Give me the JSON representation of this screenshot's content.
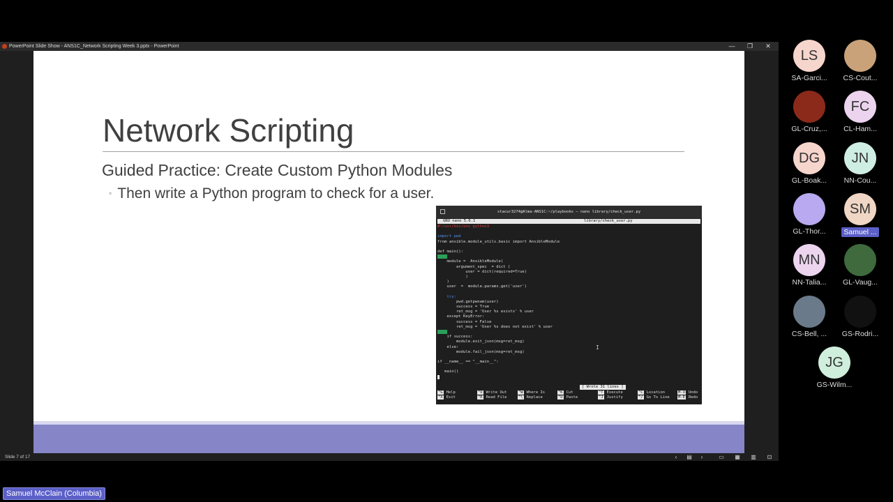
{
  "window": {
    "title": "PowerPoint Slide Show  -  ANS1C_Network Scripting Week 3.pptx - PowerPoint",
    "minimize_glyph": "—",
    "restore_glyph": "❐",
    "close_glyph": "✕"
  },
  "slide": {
    "title": "Network Scripting",
    "heading": "Guided Practice: Create Custom Python Modules",
    "bullet": "Then write a Python program to check for a user.",
    "bullet_marker": "◦"
  },
  "terminal": {
    "window_title": "stacur3274@Alma-ANS1C:~/playbooks — nano library/check_user.py",
    "nano_version": "GNU nano 5.6.1",
    "file_name": "library/check_user.py",
    "code": {
      "shebang": "#!/usr/bin/env python3",
      "l1": "import pwd",
      "l2": "from ansible.module_utils.basic import AnsibleModule",
      "l3": "def main():",
      "l4": "    module =  AnsibleModule(",
      "l5": "        argument_spec  = dict (",
      "l6": "            user = dict(required=True)",
      "l7": "            )",
      "l8": "    )",
      "l9": "    user  =  module.params.get('user')",
      "l10": "    try:",
      "l11": "        pwd.getpwnam(user)",
      "l12": "        success = True",
      "l13": "        ret_msg = 'User %s exists' % user",
      "l14": "    except KeyError:",
      "l15": "        success = False",
      "l16": "        ret_msg = 'User %s does not exist' % user",
      "l17": "    if success:",
      "l18": "        module.exit_json(msg=ret_msg)",
      "l19": "    else:",
      "l20": "        module.fail_json(msg=ret_msg)",
      "l21": "if __name__ == \"__main__\":",
      "l22": "   main()"
    },
    "status_message": "[ Wrote 31 lines ]",
    "shortcuts": [
      {
        "key": "^G",
        "label": "Help"
      },
      {
        "key": "^O",
        "label": "Write Out"
      },
      {
        "key": "^W",
        "label": "Where Is"
      },
      {
        "key": "^K",
        "label": "Cut"
      },
      {
        "key": "^T",
        "label": "Execute"
      },
      {
        "key": "^C",
        "label": "Location"
      },
      {
        "key": "M-U",
        "label": "Undo"
      },
      {
        "key": "^X",
        "label": "Exit"
      },
      {
        "key": "^R",
        "label": "Read File"
      },
      {
        "key": "^\\",
        "label": "Replace"
      },
      {
        "key": "^U",
        "label": "Paste"
      },
      {
        "key": "^J",
        "label": "Justify"
      },
      {
        "key": "^/",
        "label": "Go To Line"
      },
      {
        "key": "M-E",
        "label": "Redo"
      }
    ]
  },
  "statusbar": {
    "slide_count": "Slide 7 of 17"
  },
  "participants": [
    {
      "initials": "LS",
      "name": "SA-Garci...",
      "color": "#f6d5cc",
      "photo": false
    },
    {
      "initials": "",
      "name": "CS-Cout...",
      "color": "#c9a27a",
      "photo": true
    },
    {
      "initials": "",
      "name": "GL-Cruz,...",
      "color": "#8b2a1a",
      "photo": true
    },
    {
      "initials": "FC",
      "name": "CL-Ham...",
      "color": "#ecd4ef",
      "photo": false
    },
    {
      "initials": "DG",
      "name": "GL-Boak...",
      "color": "#f6d5cc",
      "photo": false
    },
    {
      "initials": "JN",
      "name": "NN-Cou...",
      "color": "#cfeee3",
      "photo": false
    },
    {
      "initials": "",
      "name": "GL-Thor...",
      "color": "#b8a9f0",
      "photo": true
    },
    {
      "initials": "SM",
      "name": "Samuel ...",
      "color": "#f0d6c4",
      "photo": false
    },
    {
      "initials": "MN",
      "name": "NN-Talia...",
      "color": "#ecd4ef",
      "photo": false
    },
    {
      "initials": "",
      "name": "GL-Vaug...",
      "color": "#3e6a3e",
      "photo": true
    },
    {
      "initials": "",
      "name": "CS-Bell, ...",
      "color": "#6a7a8a",
      "photo": true
    },
    {
      "initials": "",
      "name": "GS-Rodri...",
      "color": "#111111",
      "photo": true
    },
    {
      "initials": "JG",
      "name": "GS-Wilm...",
      "color": "#cfeedc",
      "photo": false
    }
  ],
  "speaker": {
    "name": "Samuel McClain (Columbia)"
  }
}
